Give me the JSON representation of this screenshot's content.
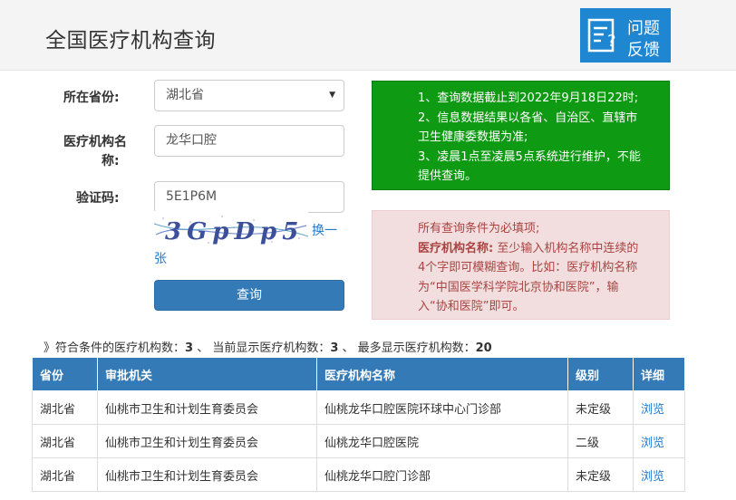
{
  "header": {
    "title": "全国医疗机构查询",
    "feedback_line1": "问题",
    "feedback_line2": "反馈"
  },
  "form": {
    "province_label": "所在省份:",
    "province_value": "湖北省",
    "name_label_1": "医疗机构名",
    "name_label_2": "称:",
    "name_value": "龙华口腔",
    "code_label": "验证码:",
    "code_value": "5E1P6M",
    "captcha_text": "3GpDp5",
    "refresh_1": "换一",
    "refresh_2": "张",
    "query_label": "查询"
  },
  "notice_green": [
    "1、查询数据截止到2022年9月18日22时;",
    "2、信息数据结果以各省、自治区、直辖市",
    "卫生健康委数据为准;",
    "3、凌晨1点至凌晨5点系统进行维护，不能",
    "提供查询。"
  ],
  "notice_red": {
    "line1": "所有查询条件为必填项;",
    "line2_bold": "医疗机构名称:",
    "line2_rest": " 至少输入机构名称中连续的",
    "line3": "4个字即可模糊查询。比如：医疗机构名称",
    "line4": "为“中国医学科学院北京协和医院”，输",
    "line5": "入“协和医院”即可。"
  },
  "summary": {
    "prefix": "》符合条件的医疗机构数：",
    "match_count": "3",
    "sep1": " 、 当前显示医疗机构数：",
    "shown_count": "3",
    "sep2": " 、 最多显示医疗机构数：",
    "max_count": "20"
  },
  "table": {
    "headers": [
      "省份",
      "审批机关",
      "医疗机构名称",
      "级别",
      "详细"
    ],
    "rows": [
      [
        "湖北省",
        "仙桃市卫生和计划生育委员会",
        "仙桃龙华口腔医院环球中心门诊部",
        "未定级",
        "浏览"
      ],
      [
        "湖北省",
        "仙桃市卫生和计划生育委员会",
        "仙桃龙华口腔医院",
        "二级",
        "浏览"
      ],
      [
        "湖北省",
        "仙桃市卫生和计划生育委员会",
        "仙桃龙华口腔门诊部",
        "未定级",
        "浏览"
      ]
    ]
  },
  "colors": {
    "primary": "#337ab7",
    "notice_green": "#0f9a13",
    "notice_red_bg": "#f2dede",
    "notice_red_text": "#a94442",
    "link": "#1f7ad0"
  }
}
